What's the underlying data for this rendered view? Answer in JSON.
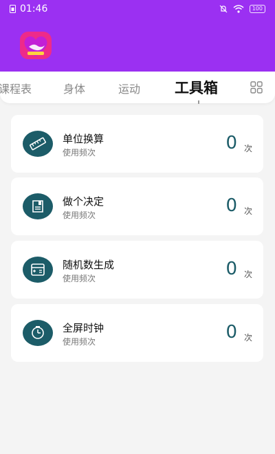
{
  "status_bar": {
    "time": "01:46",
    "battery": "100"
  },
  "tabs": [
    "课程表",
    "身体",
    "运动",
    "工具箱"
  ],
  "active_tab": "工具箱",
  "colors": {
    "brand": "#9b30f2",
    "icon_bg": "#1c5c68",
    "logo_pink": "#ee2a8a"
  },
  "tools": [
    {
      "title": "单位换算",
      "subtitle": "使用频次",
      "count": "0",
      "unit": "次",
      "icon": "ruler-icon"
    },
    {
      "title": "做个决定",
      "subtitle": "使用频次",
      "count": "0",
      "unit": "次",
      "icon": "note-icon"
    },
    {
      "title": "随机数生成",
      "subtitle": "使用频次",
      "count": "0",
      "unit": "次",
      "icon": "calculator-icon"
    },
    {
      "title": "全屏时钟",
      "subtitle": "使用频次",
      "count": "0",
      "unit": "次",
      "icon": "clock-icon"
    }
  ]
}
